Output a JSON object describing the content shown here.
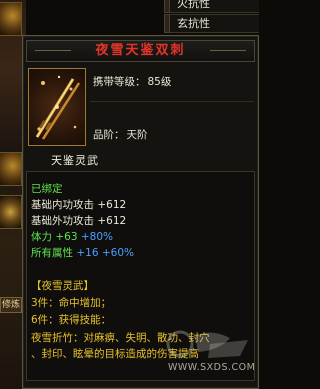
{
  "resists": [
    {
      "label": "火抗性"
    },
    {
      "label": "玄抗性"
    }
  ],
  "background": {
    "side_tab_label": "修炼"
  },
  "item": {
    "name": "夜雪天鉴双刺",
    "level_label": "携带等级：",
    "level_value": "85级",
    "rank_label": "品阶：",
    "rank_value": "天阶",
    "category": "天鉴灵武"
  },
  "stats": {
    "bound": "已绑定",
    "lines": [
      {
        "label": "基础内功攻击",
        "value": "+612"
      },
      {
        "label": "基础外功攻击",
        "value": "+612"
      },
      {
        "label": "体力",
        "value": "+63",
        "bonus": "+80%"
      },
      {
        "label": "所有属性",
        "value": "+16",
        "bonus": "+60%"
      }
    ]
  },
  "set": {
    "name": "【夜雪灵武】",
    "bonus_3": "3件：命中增加；",
    "bonus_6": "6件：获得技能：",
    "skill": "夜雪折竹：对麻痹、失明、散功、封穴",
    "skill_cont": "、封印、眩晕的目标造成的伤害提高"
  },
  "watermark": {
    "text": "WWW.SXDS.COM"
  },
  "colors": {
    "title": "#e4342a",
    "bound": "#5ee24e",
    "bonus": "#4aa0ff",
    "set_header": "#f0cd2c",
    "frame": "#a07a34"
  },
  "icons": {
    "item": "twin-daggers-icon",
    "bg_item": "equipment-slot-icon"
  }
}
